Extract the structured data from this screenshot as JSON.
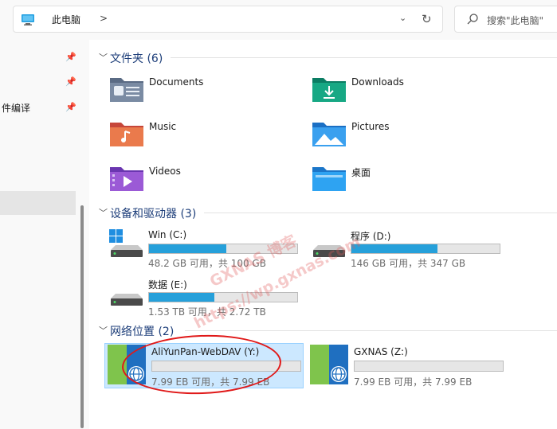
{
  "address": {
    "location": "此电脑",
    "separator": ">",
    "dropdown": "⌄",
    "refresh": "↻"
  },
  "search": {
    "placeholder": "搜索\"此电脑\""
  },
  "nav": {
    "item_label": "件编译"
  },
  "sections": {
    "folders": {
      "title": "文件夹 (6)"
    },
    "devices": {
      "title": "设备和驱动器 (3)"
    },
    "network": {
      "title": "网络位置 (2)"
    }
  },
  "folders": [
    {
      "name": "Documents",
      "icon": "documents-folder-icon"
    },
    {
      "name": "Downloads",
      "icon": "downloads-folder-icon"
    },
    {
      "name": "Music",
      "icon": "music-folder-icon"
    },
    {
      "name": "Pictures",
      "icon": "pictures-folder-icon"
    },
    {
      "name": "Videos",
      "icon": "videos-folder-icon"
    },
    {
      "name": "桌面",
      "icon": "desktop-folder-icon"
    }
  ],
  "drives": [
    {
      "name": "Win (C:)",
      "info": "48.2 GB 可用，共 100 GB",
      "used_fraction": 0.52
    },
    {
      "name": "程序 (D:)",
      "info": "146 GB 可用，共 347 GB",
      "used_fraction": 0.58
    },
    {
      "name": "数据 (E:)",
      "info": "1.53 TB 可用，共 2.72 TB",
      "used_fraction": 0.44
    }
  ],
  "network_drives": [
    {
      "name": "AliYunPan-WebDAV (Y:)",
      "info": "7.99 EB 可用，共 7.99 EB",
      "used_fraction": 0.0
    },
    {
      "name": "GXNAS (Z:)",
      "info": "7.99 EB 可用，共 7.99 EB",
      "used_fraction": 0.0
    }
  ],
  "watermark": {
    "line1": "GXNAS 博客",
    "line2": "https://wp.gxnas.com"
  },
  "colors": {
    "accent": "#26a0da",
    "section_title": "#1c3d79",
    "selection": "#cce8ff",
    "annotation": "#e01919"
  }
}
